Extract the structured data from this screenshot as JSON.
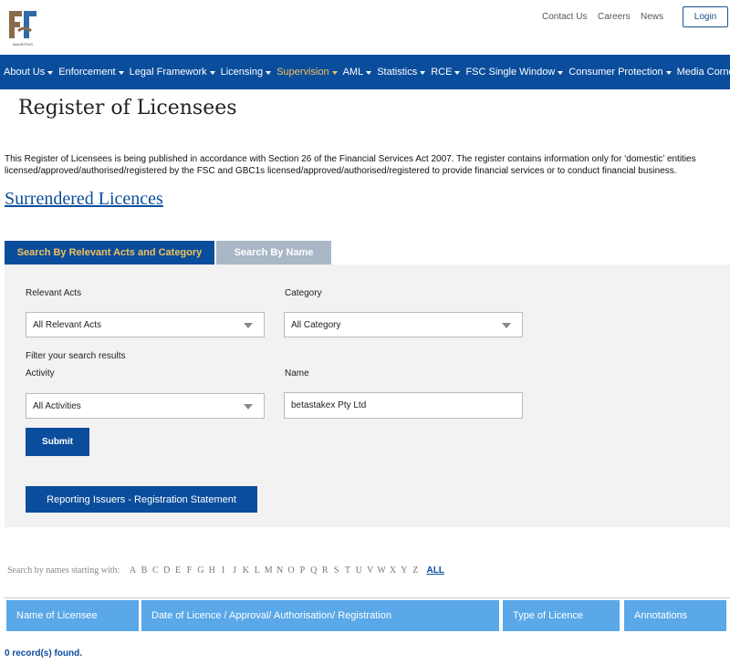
{
  "header": {
    "logo_text": "MAURITIUS",
    "links": [
      "Contact Us",
      "Careers",
      "News"
    ],
    "login_label": "Login"
  },
  "nav": {
    "items": [
      {
        "label": "About Us",
        "active": false
      },
      {
        "label": "Enforcement",
        "active": false
      },
      {
        "label": "Legal Framework",
        "active": false
      },
      {
        "label": "Licensing",
        "active": false
      },
      {
        "label": "Supervision",
        "active": true
      },
      {
        "label": "AML",
        "active": false
      },
      {
        "label": "Statistics",
        "active": false
      },
      {
        "label": "RCE",
        "active": false
      },
      {
        "label": "FSC Single Window",
        "active": false
      },
      {
        "label": "Consumer Protection",
        "active": false
      },
      {
        "label": "Media Corner",
        "active": false
      }
    ]
  },
  "page": {
    "title": "Register of Licensees",
    "intro": "This Register of Licensees is being published in accordance with Section 26 of the Financial Services Act 2007. The register contains information only for ‘domestic’ entities licensed/approved/authorised/registered by the FSC and GBC1s licensed/approved/authorised/registered to provide financial services or to conduct financial business.",
    "surrendered_link": "Surrendered Licences"
  },
  "tabs": [
    {
      "label": "Search By Relevant Acts and Category",
      "active": true
    },
    {
      "label": "Search By Name",
      "active": false
    }
  ],
  "form": {
    "relevant_acts_label": "Relevant Acts",
    "relevant_acts_value": "All Relevant Acts",
    "category_label": "Category",
    "category_value": "All Category",
    "filter_label": "Filter your search results",
    "activity_label": "Activity",
    "activity_value": "All Activities",
    "name_label": "Name",
    "name_value": "betastakex Pty Ltd",
    "submit_label": "Submit",
    "report_label": "Reporting Issuers - Registration Statement"
  },
  "alpha": {
    "label": "Search by names starting with:",
    "letters": [
      "A",
      "B",
      "C",
      "D",
      "E",
      "F",
      "G",
      "H",
      "I",
      "J",
      "K",
      "L",
      "M",
      "N",
      "O",
      "P",
      "Q",
      "R",
      "S",
      "T",
      "U",
      "V",
      "W",
      "X",
      "Y",
      "Z"
    ],
    "all_label": "ALL"
  },
  "table": {
    "headers": [
      "Name of Licensee",
      "Date of Licence / Approval/ Authorisation/ Registration",
      "Type of Licence",
      "Annotations"
    ],
    "records_text": "0 record(s) found."
  },
  "colors": {
    "brand_blue": "#0a4d9c",
    "accent_gold": "#f0c15b",
    "header_blue": "#5aa8e8"
  }
}
